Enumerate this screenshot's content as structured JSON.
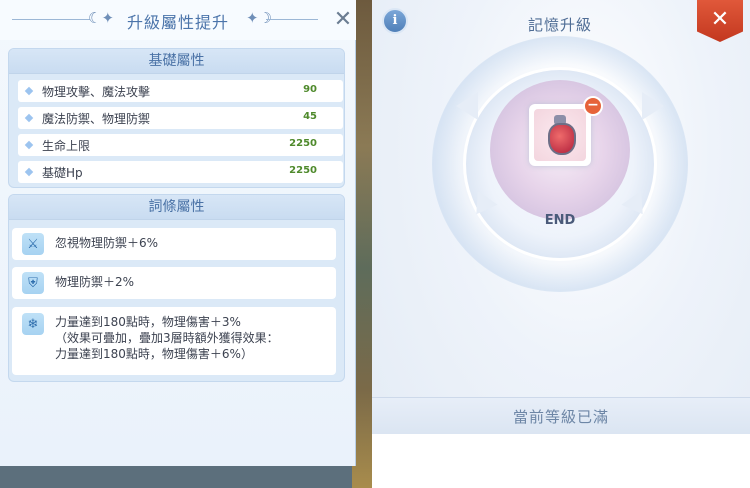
{
  "left": {
    "title": "升級屬性提升",
    "close_glyph": "✕",
    "base_section": {
      "title": "基礎屬性",
      "rows": [
        {
          "label": "物理攻擊、魔法攻擊",
          "value": "90"
        },
        {
          "label": "魔法防禦、物理防禦",
          "value": "45"
        },
        {
          "label": "生命上限",
          "value": "2250"
        },
        {
          "label": "基礎Hp",
          "value": "2250"
        }
      ]
    },
    "trait_section": {
      "title": "詞條屬性",
      "traits": [
        {
          "icon": "sword-pierce-icon",
          "icon_glyph": "⚔",
          "text": "忽視物理防禦＋6%"
        },
        {
          "icon": "shield-icon",
          "icon_glyph": "⛨",
          "text": "物理防禦＋2%"
        },
        {
          "icon": "snowflake-icon",
          "icon_glyph": "❄",
          "text": "力量達到180點時，物理傷害＋3%\n（效果可疊加，疊加3層時額外獲得效果：\n力量達到180點時，物理傷害＋6%）"
        }
      ]
    }
  },
  "right": {
    "info_glyph": "i",
    "close_glyph": "✕",
    "title": "記憶升級",
    "level_label": "END",
    "minus_glyph": "−",
    "status_text": "當前等級已滿"
  },
  "colors": {
    "accent": "#4b74aa",
    "value_green": "#4f8a2c",
    "close_red": "#d0462a"
  }
}
